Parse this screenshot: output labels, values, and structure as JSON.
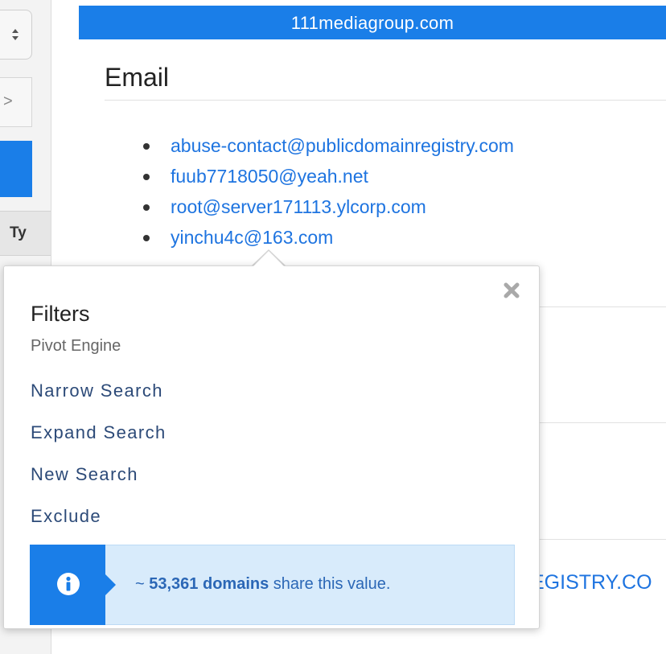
{
  "left": {
    "next_glyph": ">",
    "column_header": "Ty"
  },
  "domain": "111mediagroup.com",
  "section": {
    "title": "Email",
    "emails": [
      "abuse-contact@publicdomainregistry.com",
      "fuub7718050@yeah.net",
      "root@server171113.ylcorp.com",
      "yinchu4c@163.com"
    ]
  },
  "background_partial_text": "EGISTRY.CO",
  "popover": {
    "title": "Filters",
    "subtitle": "Pivot Engine",
    "actions": [
      "Narrow Search",
      "Expand Search",
      "New Search",
      "Exclude"
    ],
    "info": {
      "prefix": "~ ",
      "count": "53,361 domains",
      "suffix": " share this value."
    }
  },
  "colors": {
    "accent_blue": "#1a7ee8",
    "link_blue": "#1e74e0",
    "action_navy": "#2c4a78",
    "info_bg": "#d8ebfb"
  },
  "icons": {
    "close": "close-icon",
    "info": "info-icon",
    "sort": "sort-icon"
  }
}
